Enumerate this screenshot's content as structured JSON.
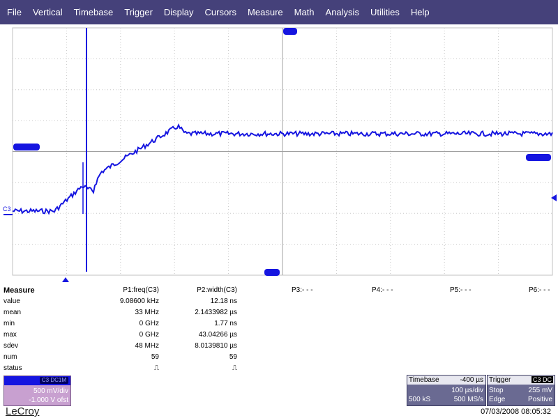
{
  "menu": [
    "File",
    "Vertical",
    "Timebase",
    "Trigger",
    "Display",
    "Cursors",
    "Measure",
    "Math",
    "Analysis",
    "Utilities",
    "Help"
  ],
  "trace": {
    "label": "C3",
    "color": "#1515e0"
  },
  "measure": {
    "title": "Measure",
    "row_labels": [
      "value",
      "mean",
      "min",
      "max",
      "sdev",
      "num",
      "status"
    ],
    "p1": {
      "header": "P1:freq(C3)",
      "values": [
        "9.08600 kHz",
        "33 MHz",
        "0 GHz",
        "0 GHz",
        "48 MHz",
        "59",
        "⎍"
      ]
    },
    "p2": {
      "header": "P2:width(C3)",
      "values": [
        "12.18 ns",
        "2.1433982 µs",
        "1.77 ns",
        "43.04266 µs",
        "8.0139810 µs",
        "59",
        "⎍"
      ]
    },
    "p3": "P3:- - -",
    "p4": "P4:- - -",
    "p5": "P5:- - -",
    "p6": "P6:- - -"
  },
  "channel": {
    "tag": "C3 DC1M",
    "vdiv": "500 mV/div",
    "offset": "-1.000 V ofst"
  },
  "timebase": {
    "title": "Timebase",
    "delay": "-400 µs",
    "tdiv": "100 µs/div",
    "samples": "500 kS",
    "rate": "500 MS/s"
  },
  "trigger": {
    "title": "Trigger",
    "tag": "C3 DC",
    "mode": "Stop",
    "level": "255 mV",
    "type": "Edge",
    "slope": "Positive"
  },
  "footer": {
    "logo": "LeCroy",
    "datetime": "07/03/2008 08:05:32"
  },
  "colors": {
    "menubar": "#45417a",
    "trace": "#1515e0"
  }
}
